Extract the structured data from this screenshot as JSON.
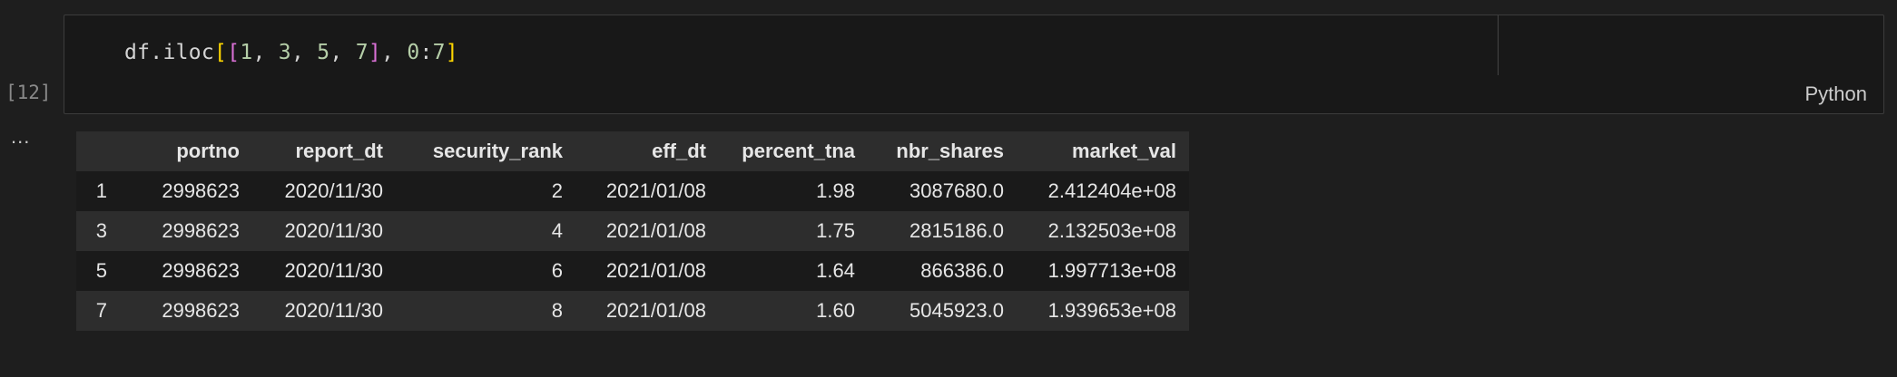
{
  "cell": {
    "execution_count": "[12]",
    "language": "Python",
    "output_more": "...",
    "code": {
      "ident": "df.iloc",
      "open_outer": "[",
      "open_inner": "[",
      "n1": "1",
      "sep1": ", ",
      "n3": "3",
      "sep2": ", ",
      "n5": "5",
      "sep3": ", ",
      "n7": "7",
      "close_inner": "]",
      "sep4": ", ",
      "slice_start": "0",
      "colon": ":",
      "slice_end": "7",
      "close_outer": "]"
    }
  },
  "table": {
    "columns": [
      "",
      "portno",
      "report_dt",
      "security_rank",
      "eff_dt",
      "percent_tna",
      "nbr_shares",
      "market_val"
    ],
    "rows": [
      {
        "index": "1",
        "portno": "2998623",
        "report_dt": "2020/11/30",
        "security_rank": "2",
        "eff_dt": "2021/01/08",
        "percent_tna": "1.98",
        "nbr_shares": "3087680.0",
        "market_val": "2.412404e+08"
      },
      {
        "index": "3",
        "portno": "2998623",
        "report_dt": "2020/11/30",
        "security_rank": "4",
        "eff_dt": "2021/01/08",
        "percent_tna": "1.75",
        "nbr_shares": "2815186.0",
        "market_val": "2.132503e+08"
      },
      {
        "index": "5",
        "portno": "2998623",
        "report_dt": "2020/11/30",
        "security_rank": "6",
        "eff_dt": "2021/01/08",
        "percent_tna": "1.64",
        "nbr_shares": "866386.0",
        "market_val": "1.997713e+08"
      },
      {
        "index": "7",
        "portno": "2998623",
        "report_dt": "2020/11/30",
        "security_rank": "8",
        "eff_dt": "2021/01/08",
        "percent_tna": "1.60",
        "nbr_shares": "5045923.0",
        "market_val": "1.939653e+08"
      }
    ]
  },
  "colors": {
    "background": "#1e1e1e",
    "editor_background": "#181818",
    "bracket_outer": "#ffd700",
    "bracket_inner": "#da70d6",
    "number": "#b5cea8",
    "table_stripe": "#2d2d2d"
  }
}
